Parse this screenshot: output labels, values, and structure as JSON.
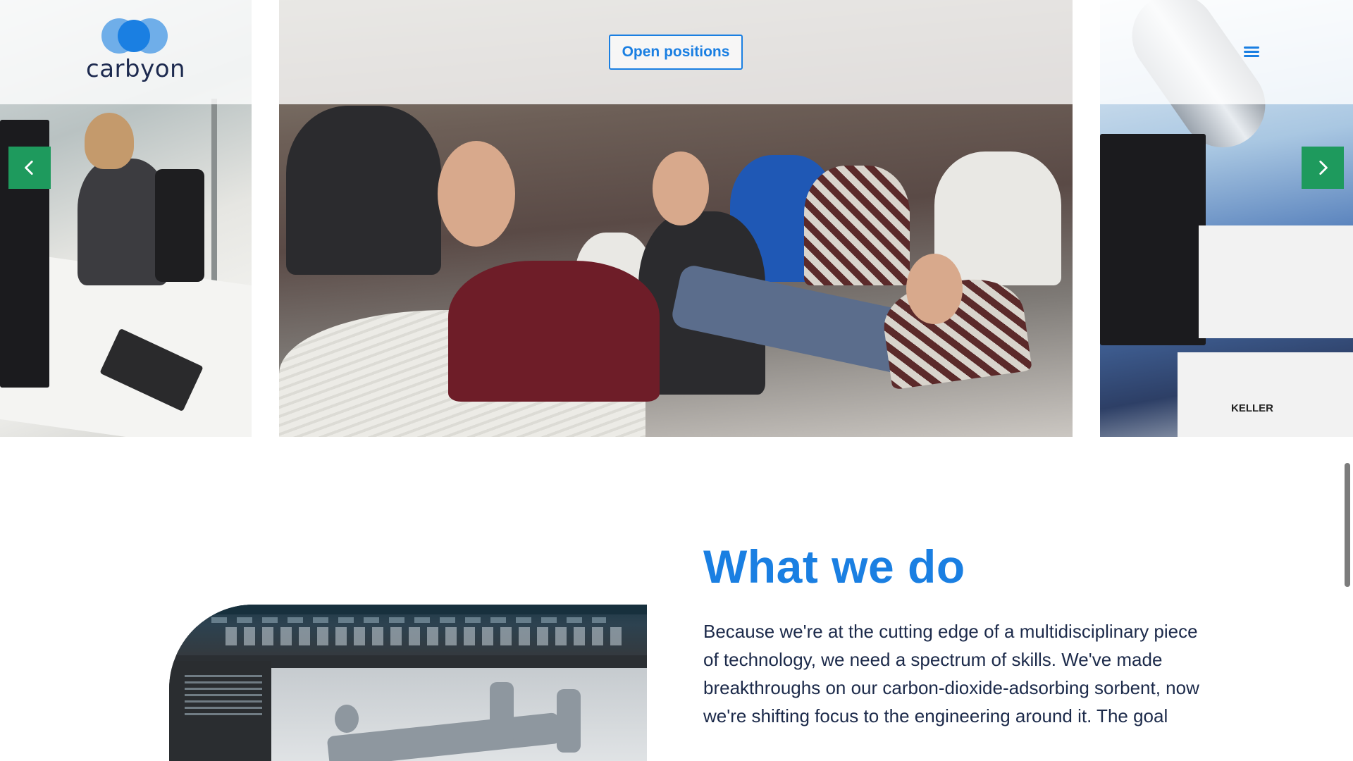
{
  "header": {
    "logo_text": "carbyon",
    "cta_label": "Open positions"
  },
  "icons": {
    "logo": "carbyon-logo-icon",
    "menu": "hamburger-menu-icon",
    "prev": "chevron-left-icon",
    "next": "chevron-right-icon"
  },
  "carousel": {
    "slides": [
      {
        "label": "office-workstation-photo"
      },
      {
        "label": "team-meeting-photo"
      },
      {
        "label": "lab-bench-photo"
      }
    ],
    "photo_text": {
      "lab_box_label": "KELLER"
    }
  },
  "content": {
    "title": "What we do",
    "body": "Because we're at the cutting edge of a multidisciplinary piece of technology, we need a spectrum of skills. We've made breakthroughs on our carbon-dioxide-adsorbing sorbent, now we're shifting focus to the engineering around it. The goal"
  },
  "colors": {
    "brand_blue": "#1a7fe2",
    "logo_light_blue": "#6faee9",
    "logo_text": "#1d2a4f",
    "arrow_green": "#1e9a5d"
  }
}
